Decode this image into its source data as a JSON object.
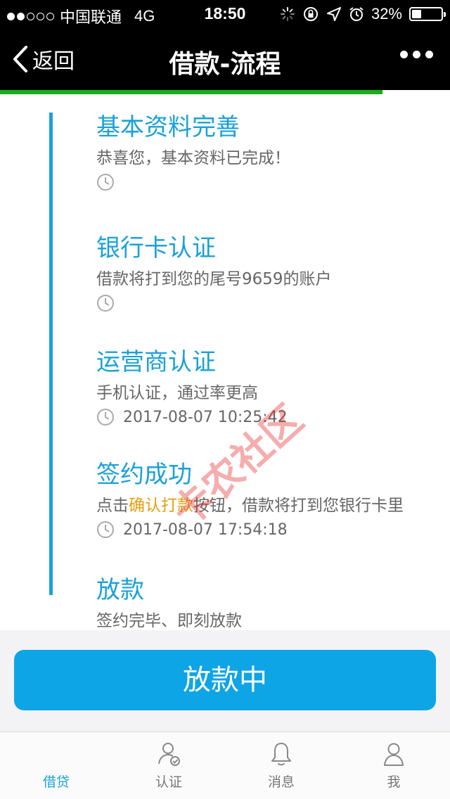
{
  "status_bar": {
    "carrier": "中国联通",
    "network": "4G",
    "time": "18:50",
    "battery": "32%",
    "battery_level": 0.32
  },
  "nav": {
    "back_label": "返回",
    "title": "借款-流程"
  },
  "progress_fraction": 0.85,
  "steps": [
    {
      "title": "基本资料完善",
      "desc": "恭喜您，基本资料已完成！",
      "time": ""
    },
    {
      "title": "银行卡认证",
      "desc": "借款将打到您的尾号9659的账户",
      "time": ""
    },
    {
      "title": "运营商认证",
      "desc": "手机认证，通过率更高",
      "time": "2017-08-07 10:25:42"
    },
    {
      "title": "签约成功",
      "desc_prefix": "点击",
      "desc_highlight": "确认打款",
      "desc_suffix": "按钮，借款将打到您银行卡里",
      "time": "2017-08-07 17:54:18"
    },
    {
      "title": "放款",
      "desc": "签约完毕、即刻放款"
    }
  ],
  "watermark": "卡农社区",
  "primary_button": "放款中",
  "tabs": [
    {
      "label": "借贷",
      "icon": "loan-icon"
    },
    {
      "label": "认证",
      "icon": "verify-user-icon"
    },
    {
      "label": "消息",
      "icon": "bell-icon"
    },
    {
      "label": "我",
      "icon": "person-icon"
    }
  ],
  "colors": {
    "accent": "#1aa1d8",
    "button": "#0ea5e7",
    "highlight": "#e5a00f",
    "progress": "#1aad19"
  }
}
